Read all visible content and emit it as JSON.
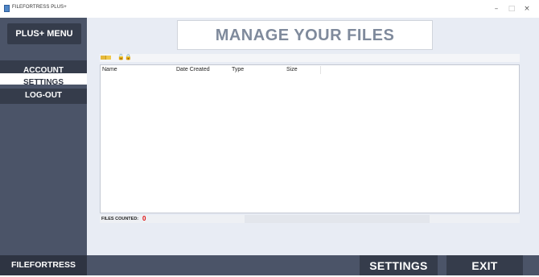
{
  "window": {
    "title": "FILEFORTRESS PLUS+",
    "controls": {
      "minimize": "–",
      "maximize": "□",
      "close": "×"
    }
  },
  "sidebar": {
    "header": "PLUS+ MENU",
    "items": [
      {
        "label": "ACCOUNT"
      },
      {
        "label": "SETTINGS"
      },
      {
        "label": "LOG-OUT"
      }
    ]
  },
  "main": {
    "banner": "MANAGE YOUR FILES",
    "toolbar_icons": [
      "folder-icon",
      "folder-open-icon",
      "lock-open-icon",
      "lock-icon"
    ],
    "table": {
      "columns": [
        "Name",
        "Date Created",
        "Type",
        "Size"
      ],
      "rows": []
    },
    "status": {
      "label": "FILES COUNTED:",
      "count": "0"
    }
  },
  "footer": {
    "brand": "FILEFORTRESS",
    "settings_label": "SETTINGS",
    "exit_label": "EXIT"
  },
  "colors": {
    "sidebar": "#4b5468",
    "sidebar_button": "#353c4b",
    "banner_text": "#7f8a9c",
    "count": "#e01010",
    "main_bg": "#e8ecf4"
  }
}
